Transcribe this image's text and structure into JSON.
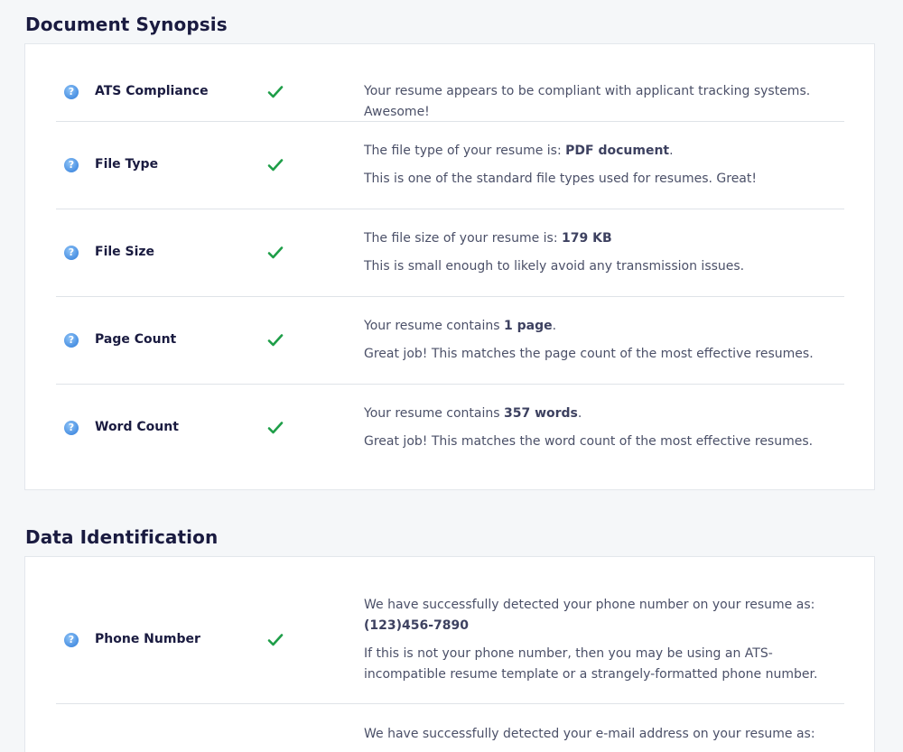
{
  "sections": {
    "synopsis": {
      "title": "Document Synopsis",
      "rows": [
        {
          "label": "ATS Compliance",
          "status_icon": "check-icon",
          "line1": "Your resume appears to be compliant with applicant tracking systems. Awesome!"
        },
        {
          "label": "File Type",
          "status_icon": "check-icon",
          "line1_prefix": "The file type of your resume is: ",
          "line1_value": "PDF document",
          "line1_suffix": ".",
          "line2": "This is one of the standard file types used for resumes. Great!"
        },
        {
          "label": "File Size",
          "status_icon": "check-icon",
          "line1_prefix": "The file size of your resume is: ",
          "line1_value": "179 KB",
          "line2": "This is small enough to likely avoid any transmission issues."
        },
        {
          "label": "Page Count",
          "status_icon": "check-icon",
          "line1_prefix": "Your resume contains ",
          "line1_value": "1 page",
          "line1_suffix": ".",
          "line2": "Great job! This matches the page count of the most effective resumes."
        },
        {
          "label": "Word Count",
          "status_icon": "check-icon",
          "line1_prefix": "Your resume contains ",
          "line1_value": "357 words",
          "line1_suffix": ".",
          "line2": "Great job! This matches the word count of the most effective resumes."
        }
      ]
    },
    "data_identification": {
      "title": "Data Identification",
      "rows": [
        {
          "label": "Phone Number",
          "status_icon": "check-icon",
          "line1": "We have successfully detected your phone number on your resume as:",
          "line1_value": "(123)456-7890",
          "line2": "If this is not your phone number, then you may be using an ATS-incompatible resume template or a strangely-formatted phone number."
        },
        {
          "line1": "We have successfully detected your e-mail address on your resume as:"
        }
      ]
    }
  },
  "icons": {
    "help_glyph": "?",
    "help_icon": "question-circle-icon",
    "check_color": "#1e9e48"
  },
  "colors": {
    "background": "#f5f7f9",
    "card": "#ffffff",
    "title": "#1a1b40",
    "text": "#4b5068",
    "help_blue": "#4a90e2"
  }
}
